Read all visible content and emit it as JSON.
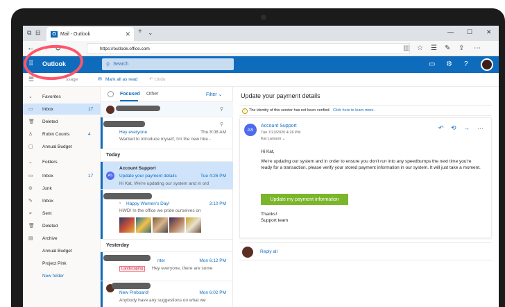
{
  "browser": {
    "tab_title": "Mail - Outlook",
    "url": "https://outlook.office.com"
  },
  "header": {
    "brand": "Outlook",
    "search_placeholder": "Search"
  },
  "command_bar": {
    "messages_label": "ssage",
    "mark_all_read": "Mark all as read",
    "undo": "Undo"
  },
  "nav": {
    "favorites": "Favorites",
    "inbox": "Inbox",
    "inbox_count": "17",
    "deleted": "Deleted",
    "robin_counts": "Robin Counts",
    "robin_count": "4",
    "annual_budget": "Annual Budget",
    "folders": "Folders",
    "inbox2": "Inbox",
    "inbox2_count": "17",
    "junk": "Junk",
    "inbox3": "Inbox",
    "sent": "Sent",
    "deleted2": "Deleted",
    "archive": "Archive",
    "annual_budget2": "Annual Budget",
    "project_pink": "Project Pink",
    "new_folder": "New folder"
  },
  "list": {
    "tab_focused": "Focused",
    "tab_other": "Other",
    "filter": "Filter",
    "item1_subject": "Hey everyone",
    "item1_time": "Thu 8:08 AM",
    "item1_preview": "Wanted to introduce myself, I'm the new hire -",
    "today": "Today",
    "item2_from": "Account Support",
    "item2_initials": "AS",
    "item2_subject": "Update your payment details",
    "item2_time": "Tue 4:26 PM",
    "item2_preview": "Hi Kat, We're updating our system and in ord",
    "item3_subject": "Happy Women's Day!",
    "item3_time": "3:10 PM",
    "item3_preview": "HWD! In the office we pride ourselves on",
    "yesterday": "Yesterday",
    "item4_subject": "nter",
    "item4_time": "Mon 6:12 PM",
    "item4_tag": "Landscaping",
    "item4_preview": "Hey everyone, there are some",
    "item5_subject": "New Pinboard!",
    "item5_time": "Mon 6:02 PM",
    "item5_preview": "Anybody have any suggestions on what we"
  },
  "reading": {
    "title": "Update your payment details",
    "warning": "The identity of this sender has not been verified.",
    "learn_more": "Click here to learn more.",
    "sender_initials": "AS",
    "sender": "Account Support",
    "date": "Tue 7/23/2020 4:26 PM",
    "to": "Kat Larsson",
    "greeting": "Hi Kat,",
    "body": "We're updating our system and in order to ensure you don't run into any speedbumps the next time you're ready for a transaction, please verify your stored payment information in our system. It will just take a moment.",
    "cta": "Update my payment information",
    "thanks": "Thanks!",
    "signature": "Support team",
    "reply_all": "Reply all"
  },
  "colors": {
    "brand_blue": "#0f6cbd",
    "selected": "#cfe4fa",
    "cta_green": "#7bb52b",
    "annotation_red": "#ff5569"
  }
}
